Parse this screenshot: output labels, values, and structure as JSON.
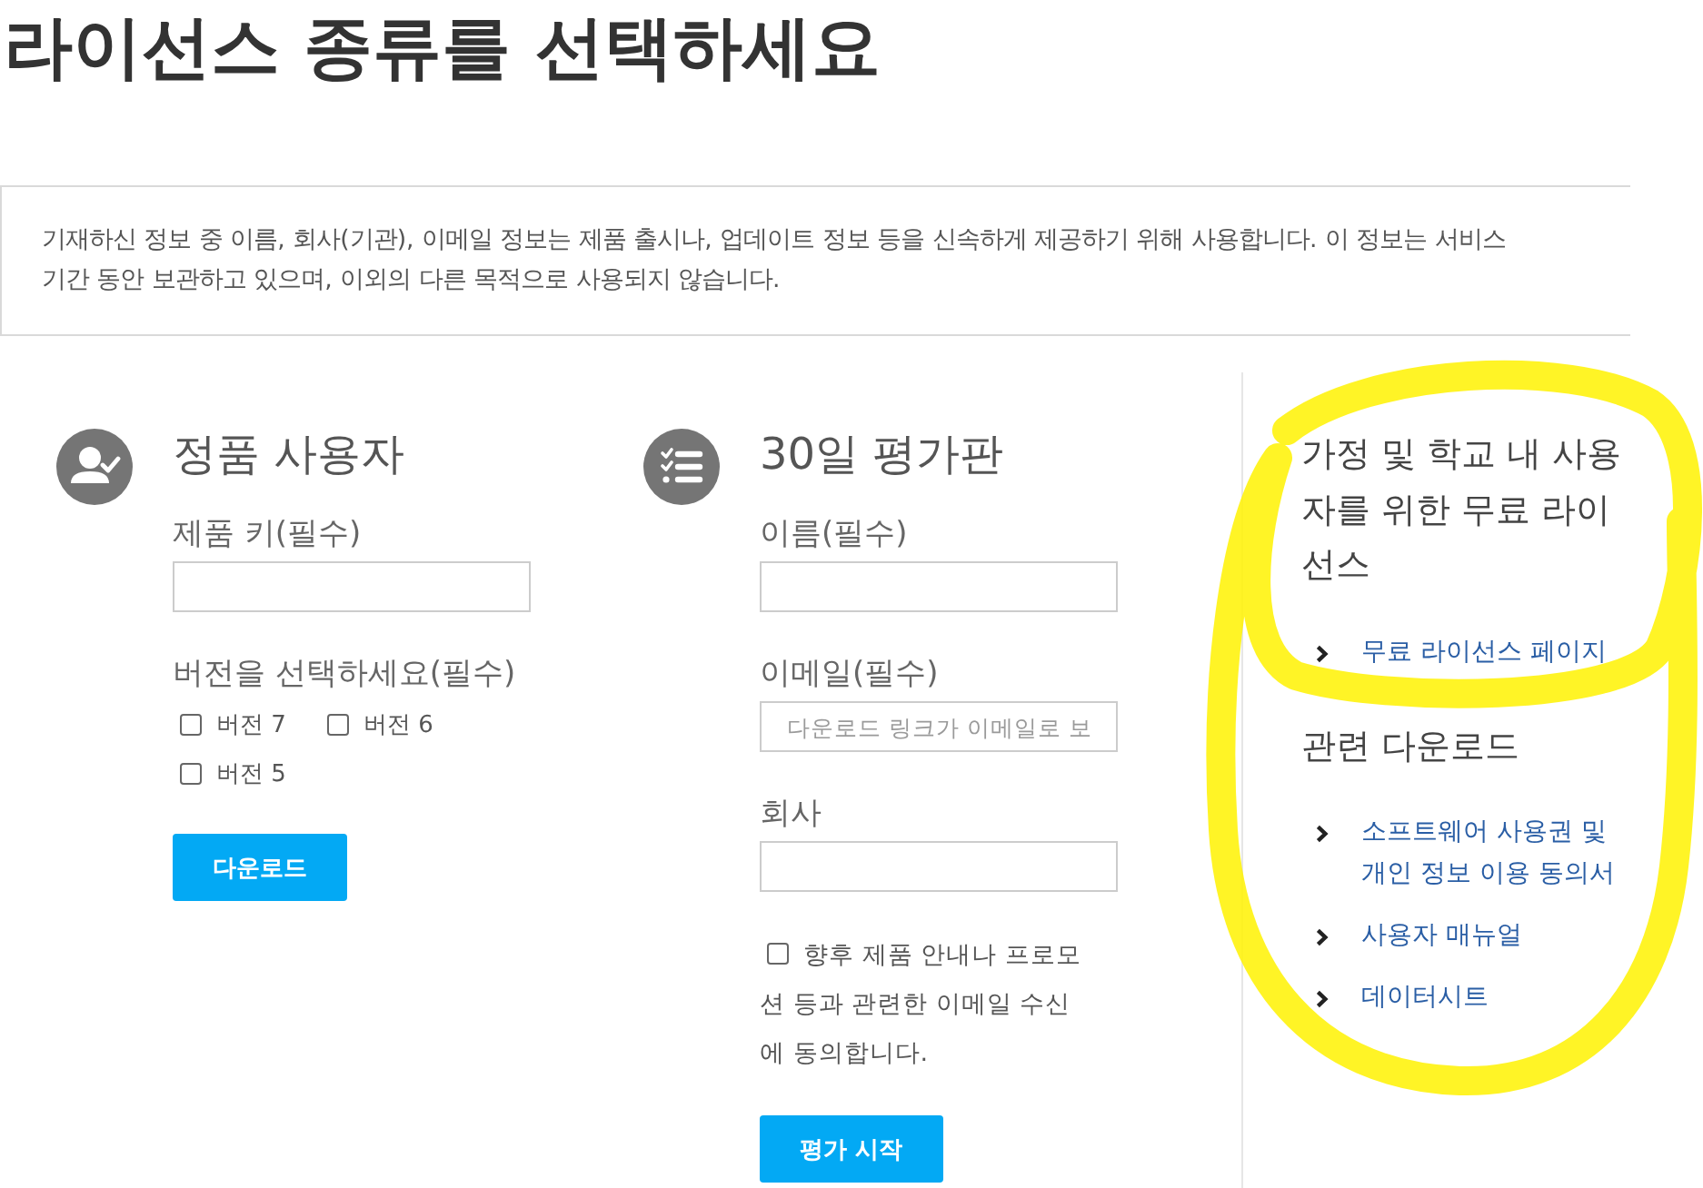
{
  "page": {
    "title": "라이선스 종류를 선택하세요"
  },
  "notice": "기재하신 정보 중 이름, 회사(기관), 이메일 정보는 제품 출시나, 업데이트 정보 등을 신속하게 제공하기 위해 사용합니다. 이 정보는 서비스 기간 동안 보관하고 있으며, 이외의 다른 목적으로 사용되지 않습니다.",
  "panels": [
    {
      "kind": "full-version",
      "heading": "정품 사용자",
      "items": [
        {
          "kind": "text-field",
          "label": "제품 키(필수)"
        },
        {
          "kind": "checkbox-group",
          "label": "버전을 선택하세요(필수)",
          "options": [
            {
              "label": "버전 7",
              "checked": false
            },
            {
              "label": "버전 6",
              "checked": false
            },
            {
              "label": "버전 5",
              "checked": false
            }
          ]
        }
      ],
      "button": "다운로드"
    },
    {
      "kind": "trial",
      "heading": "30일 평가판",
      "items": [
        {
          "kind": "text-field",
          "label": "이름(필수)"
        },
        {
          "kind": "text-field",
          "label": "이메일(필수)",
          "placeholder": "다운로드 링크가 이메일로 보"
        },
        {
          "kind": "text-field",
          "label": "회사"
        },
        {
          "kind": "consent",
          "label": "향후 제품 안내나 프로모션 등과 관련한 이메일 수신에 동의합니다.",
          "checked": false
        }
      ],
      "button": "평가 시작"
    }
  ],
  "sidebar": {
    "sections": [
      {
        "heading": "가정 및 학교 내 사용자를 위한 무료 라이선스",
        "links": [
          "무료 라이선스 페이지"
        ]
      },
      {
        "heading": "관련 다운로드",
        "links": [
          "소프트웨어 사용권 및 개인 정보 이용 동의서",
          "사용자 매뉴얼",
          "데이터시트"
        ]
      }
    ]
  }
}
